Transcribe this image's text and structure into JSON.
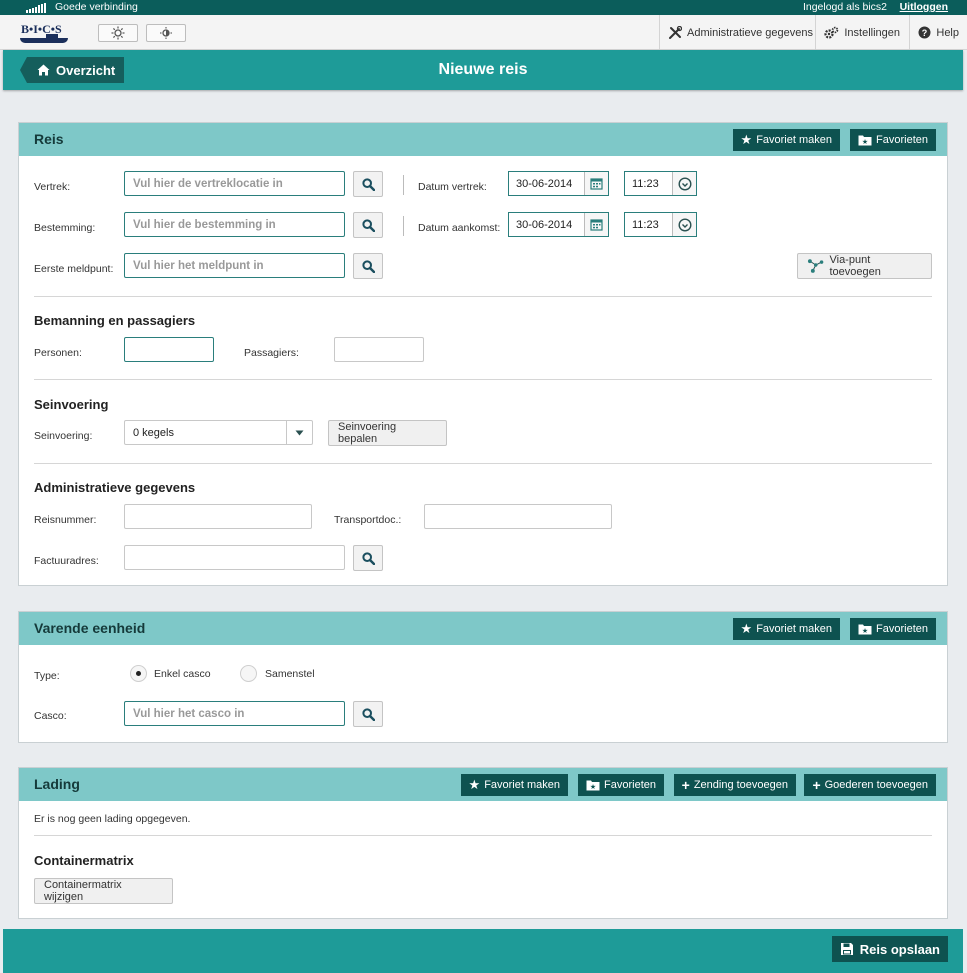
{
  "statusbar": {
    "connection": "Goede verbinding",
    "logged_in": "Ingelogd als bics2",
    "logout": "Uitloggen"
  },
  "logo": {
    "text": "B•I•C•S"
  },
  "toolbar": {
    "admin": "Administratieve gegevens",
    "settings": "Instellingen",
    "help": "Help"
  },
  "header": {
    "back": "Overzicht",
    "title": "Nieuwe reis"
  },
  "reis": {
    "title": "Reis",
    "fav_make": "Favoriet maken",
    "favorites": "Favorieten",
    "vertrek_label": "Vertrek:",
    "vertrek_placeholder": "Vul hier de vertreklocatie in",
    "bestemming_label": "Bestemming:",
    "bestemming_placeholder": "Vul hier de bestemming in",
    "meldpunt_label": "Eerste meldpunt:",
    "meldpunt_placeholder": "Vul hier het meldpunt in",
    "datum_vertrek_label": "Datum vertrek:",
    "datum_vertrek": "30-06-2014",
    "tijd_vertrek": "11:23",
    "datum_aankomst_label": "Datum aankomst:",
    "datum_aankomst": "30-06-2014",
    "tijd_aankomst": "11:23",
    "via_punt": "Via-punt toevoegen",
    "bemanning_title": "Bemanning en passagiers",
    "personen_label": "Personen:",
    "passagiers_label": "Passagiers:",
    "seinvoering_title": "Seinvoering",
    "seinvoering_label": "Seinvoering:",
    "seinvoering_value": "0 kegels",
    "seinvoering_btn": "Seinvoering bepalen",
    "admin_title": "Administratieve gegevens",
    "reisnummer_label": "Reisnummer:",
    "transportdoc_label": "Transportdoc.:",
    "factuuradres_label": "Factuuradres:"
  },
  "varende": {
    "title": "Varende eenheid",
    "fav_make": "Favoriet maken",
    "favorites": "Favorieten",
    "type_label": "Type:",
    "option1": "Enkel casco",
    "option2": "Samenstel",
    "casco_label": "Casco:",
    "casco_placeholder": "Vul hier het casco in"
  },
  "lading": {
    "title": "Lading",
    "fav_make": "Favoriet maken",
    "favorites": "Favorieten",
    "add_shipment": "Zending toevoegen",
    "add_goods": "Goederen toevoegen",
    "empty_text": "Er is nog geen lading opgegeven.",
    "container_title": "Containermatrix",
    "container_btn": "Containermatrix wijzigen"
  },
  "footer": {
    "save": "Reis opslaan"
  },
  "colors": {
    "teal": "#1e9b98",
    "dark_teal": "#0e5250",
    "panel_header": "#7ec8c8"
  }
}
